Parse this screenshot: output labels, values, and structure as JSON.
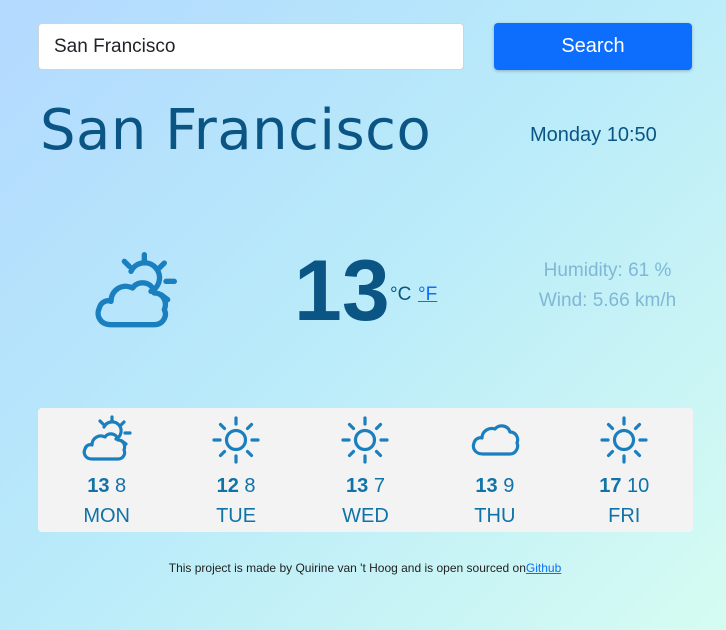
{
  "search": {
    "value": "San Francisco",
    "button_label": "Search"
  },
  "current": {
    "city": "San Francisco",
    "datetime": "Monday 10:50",
    "icon": "partly-cloudy-icon",
    "temperature": "13",
    "unit_celsius": "°C",
    "unit_fahrenheit": "°F",
    "humidity": "Humidity: 61 %",
    "wind": "Wind: 5.66 km/h"
  },
  "forecast": [
    {
      "day": "MON",
      "max": "13",
      "min": "8",
      "icon": "partly-cloudy-icon"
    },
    {
      "day": "TUE",
      "max": "12",
      "min": "8",
      "icon": "sun-icon"
    },
    {
      "day": "WED",
      "max": "13",
      "min": "7",
      "icon": "sun-icon"
    },
    {
      "day": "THU",
      "max": "13",
      "min": "9",
      "icon": "cloud-icon"
    },
    {
      "day": "FRI",
      "max": "17",
      "min": "10",
      "icon": "sun-icon"
    }
  ],
  "footer": {
    "text": "This project is made by Quirine van 't Hoog and is open sourced on",
    "link_label": "Github"
  },
  "colors": {
    "primary_text": "#0a5584",
    "accent": "#0d6efd",
    "icon": "#1a7fbf",
    "muted": "#7fb7d6"
  }
}
